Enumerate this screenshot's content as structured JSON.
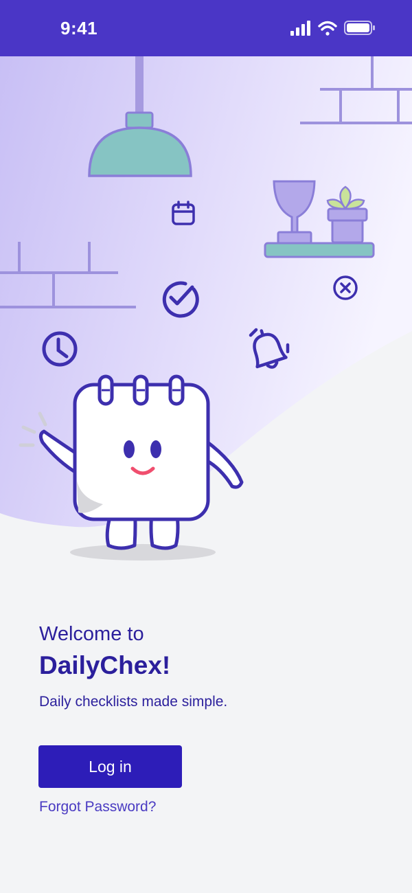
{
  "status_bar": {
    "time": "9:41"
  },
  "welcome": {
    "line1": "Welcome to",
    "app_name": "DailyChex!",
    "tagline": "Daily checklists made simple."
  },
  "actions": {
    "login_label": "Log in",
    "forgot_label": "Forgot Password?"
  },
  "colors": {
    "brand": "#4a36c6",
    "button": "#2d1db8",
    "text": "#2b1f9c",
    "background": "#f3f4f6"
  },
  "illustration_icons": [
    "ceiling-lamp-icon",
    "calendar-icon",
    "check-circle-icon",
    "clock-icon",
    "bell-icon",
    "close-circle-icon",
    "trophy-icon",
    "plant-icon",
    "calendar-mascot"
  ]
}
